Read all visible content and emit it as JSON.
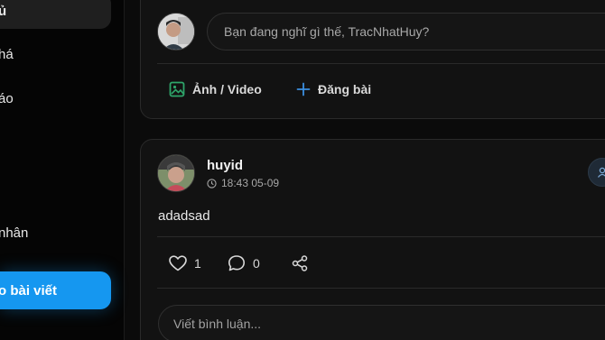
{
  "sidebar": {
    "items": [
      {
        "label": "ủ",
        "icon": "home-icon"
      },
      {
        "label": "há",
        "icon": "explore-icon"
      },
      {
        "label": "áo",
        "icon": "notification-icon"
      },
      {
        "label": "nhân",
        "icon": "profile-icon"
      }
    ],
    "create_label": "o bài viết"
  },
  "composer": {
    "placeholder": "Bạn đang nghĩ gì thế, TracNhatHuy?",
    "media_label": "Ảnh / Video",
    "post_label": "Đăng bài",
    "media_icon": "image-icon",
    "post_icon": "plus-icon"
  },
  "post": {
    "username": "huyid",
    "time": "18:43 05-09",
    "content": "adadsad",
    "likes": "1",
    "comments": "0",
    "comment_placeholder": "Viết bình luận..."
  },
  "colors": {
    "accent": "#1597f0",
    "background": "#0b0b0b",
    "card": "#121212",
    "media_green": "#2ea56a"
  }
}
